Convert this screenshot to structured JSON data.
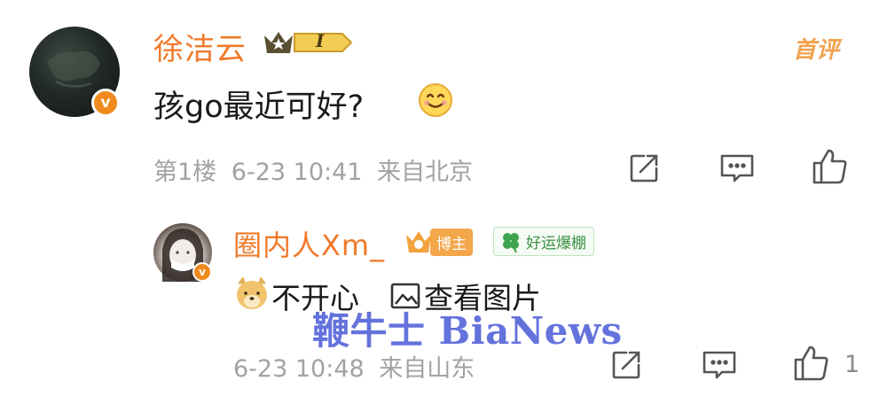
{
  "comment_main": {
    "username": "徐洁云",
    "text": "孩go最近可好?",
    "floor": "第1楼",
    "datetime": "6-23 10:41",
    "location": "来自北京",
    "first_comment_tag": "首评",
    "level_badge": "I",
    "icons": [
      "share-icon",
      "comment-icon",
      "like-icon"
    ]
  },
  "reply": {
    "username": "圈内人Xm_",
    "blogger_badge": "博主",
    "luck_badge": "好运爆棚",
    "text": "不开心",
    "view_image": "查看图片",
    "datetime": "6-23 10:48",
    "location": "来自山东",
    "like_count": "1",
    "icons": [
      "share-icon",
      "comment-icon",
      "like-icon"
    ]
  },
  "watermark": "鞭牛士 BiaNews",
  "colors": {
    "username": "#f07a2a",
    "meta": "#a2a2a2",
    "badge_orange": "#f08a1c",
    "watermark": "#4a5ad6"
  }
}
